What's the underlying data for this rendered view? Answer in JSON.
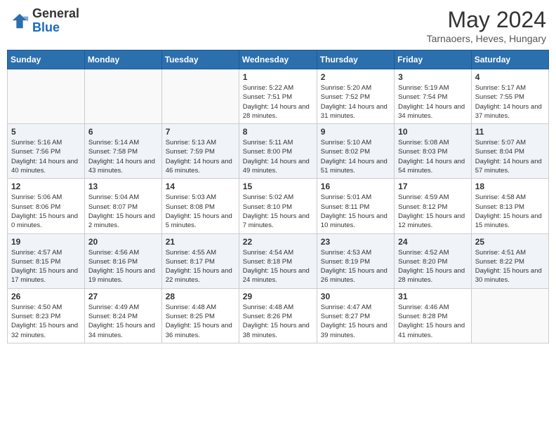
{
  "header": {
    "logo_general": "General",
    "logo_blue": "Blue",
    "month_title": "May 2024",
    "subtitle": "Tarnaoers, Heves, Hungary"
  },
  "weekdays": [
    "Sunday",
    "Monday",
    "Tuesday",
    "Wednesday",
    "Thursday",
    "Friday",
    "Saturday"
  ],
  "weeks": [
    [
      {
        "day": "",
        "info": ""
      },
      {
        "day": "",
        "info": ""
      },
      {
        "day": "",
        "info": ""
      },
      {
        "day": "1",
        "info": "Sunrise: 5:22 AM\nSunset: 7:51 PM\nDaylight: 14 hours and 28 minutes."
      },
      {
        "day": "2",
        "info": "Sunrise: 5:20 AM\nSunset: 7:52 PM\nDaylight: 14 hours and 31 minutes."
      },
      {
        "day": "3",
        "info": "Sunrise: 5:19 AM\nSunset: 7:54 PM\nDaylight: 14 hours and 34 minutes."
      },
      {
        "day": "4",
        "info": "Sunrise: 5:17 AM\nSunset: 7:55 PM\nDaylight: 14 hours and 37 minutes."
      }
    ],
    [
      {
        "day": "5",
        "info": "Sunrise: 5:16 AM\nSunset: 7:56 PM\nDaylight: 14 hours and 40 minutes."
      },
      {
        "day": "6",
        "info": "Sunrise: 5:14 AM\nSunset: 7:58 PM\nDaylight: 14 hours and 43 minutes."
      },
      {
        "day": "7",
        "info": "Sunrise: 5:13 AM\nSunset: 7:59 PM\nDaylight: 14 hours and 46 minutes."
      },
      {
        "day": "8",
        "info": "Sunrise: 5:11 AM\nSunset: 8:00 PM\nDaylight: 14 hours and 49 minutes."
      },
      {
        "day": "9",
        "info": "Sunrise: 5:10 AM\nSunset: 8:02 PM\nDaylight: 14 hours and 51 minutes."
      },
      {
        "day": "10",
        "info": "Sunrise: 5:08 AM\nSunset: 8:03 PM\nDaylight: 14 hours and 54 minutes."
      },
      {
        "day": "11",
        "info": "Sunrise: 5:07 AM\nSunset: 8:04 PM\nDaylight: 14 hours and 57 minutes."
      }
    ],
    [
      {
        "day": "12",
        "info": "Sunrise: 5:06 AM\nSunset: 8:06 PM\nDaylight: 15 hours and 0 minutes."
      },
      {
        "day": "13",
        "info": "Sunrise: 5:04 AM\nSunset: 8:07 PM\nDaylight: 15 hours and 2 minutes."
      },
      {
        "day": "14",
        "info": "Sunrise: 5:03 AM\nSunset: 8:08 PM\nDaylight: 15 hours and 5 minutes."
      },
      {
        "day": "15",
        "info": "Sunrise: 5:02 AM\nSunset: 8:10 PM\nDaylight: 15 hours and 7 minutes."
      },
      {
        "day": "16",
        "info": "Sunrise: 5:01 AM\nSunset: 8:11 PM\nDaylight: 15 hours and 10 minutes."
      },
      {
        "day": "17",
        "info": "Sunrise: 4:59 AM\nSunset: 8:12 PM\nDaylight: 15 hours and 12 minutes."
      },
      {
        "day": "18",
        "info": "Sunrise: 4:58 AM\nSunset: 8:13 PM\nDaylight: 15 hours and 15 minutes."
      }
    ],
    [
      {
        "day": "19",
        "info": "Sunrise: 4:57 AM\nSunset: 8:15 PM\nDaylight: 15 hours and 17 minutes."
      },
      {
        "day": "20",
        "info": "Sunrise: 4:56 AM\nSunset: 8:16 PM\nDaylight: 15 hours and 19 minutes."
      },
      {
        "day": "21",
        "info": "Sunrise: 4:55 AM\nSunset: 8:17 PM\nDaylight: 15 hours and 22 minutes."
      },
      {
        "day": "22",
        "info": "Sunrise: 4:54 AM\nSunset: 8:18 PM\nDaylight: 15 hours and 24 minutes."
      },
      {
        "day": "23",
        "info": "Sunrise: 4:53 AM\nSunset: 8:19 PM\nDaylight: 15 hours and 26 minutes."
      },
      {
        "day": "24",
        "info": "Sunrise: 4:52 AM\nSunset: 8:20 PM\nDaylight: 15 hours and 28 minutes."
      },
      {
        "day": "25",
        "info": "Sunrise: 4:51 AM\nSunset: 8:22 PM\nDaylight: 15 hours and 30 minutes."
      }
    ],
    [
      {
        "day": "26",
        "info": "Sunrise: 4:50 AM\nSunset: 8:23 PM\nDaylight: 15 hours and 32 minutes."
      },
      {
        "day": "27",
        "info": "Sunrise: 4:49 AM\nSunset: 8:24 PM\nDaylight: 15 hours and 34 minutes."
      },
      {
        "day": "28",
        "info": "Sunrise: 4:48 AM\nSunset: 8:25 PM\nDaylight: 15 hours and 36 minutes."
      },
      {
        "day": "29",
        "info": "Sunrise: 4:48 AM\nSunset: 8:26 PM\nDaylight: 15 hours and 38 minutes."
      },
      {
        "day": "30",
        "info": "Sunrise: 4:47 AM\nSunset: 8:27 PM\nDaylight: 15 hours and 39 minutes."
      },
      {
        "day": "31",
        "info": "Sunrise: 4:46 AM\nSunset: 8:28 PM\nDaylight: 15 hours and 41 minutes."
      },
      {
        "day": "",
        "info": ""
      }
    ]
  ]
}
